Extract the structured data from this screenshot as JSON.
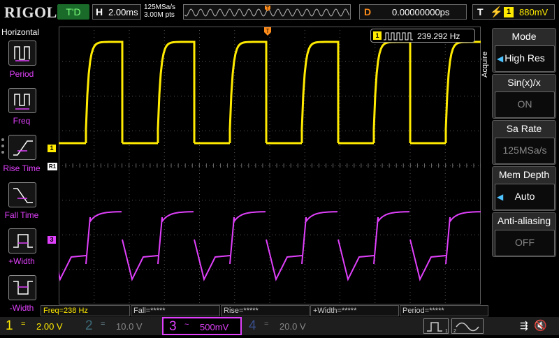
{
  "brand": "RIGOL",
  "trigger_status": "T'D",
  "horizontal": {
    "key": "H",
    "timebase": "2.00ms",
    "sample_rate": "125MSa/s",
    "points": "3.00M pts"
  },
  "delay": {
    "key": "D",
    "value": "0.00000000ps"
  },
  "trigger": {
    "key": "T",
    "edge_icon": "rising-edge-icon",
    "source": "1",
    "level": "880mV",
    "marker": "T"
  },
  "left_menu": {
    "title": "Horizontal",
    "items": [
      {
        "name": "period",
        "label": "Period"
      },
      {
        "name": "freq",
        "label": "Freq"
      },
      {
        "name": "rise-time",
        "label": "Rise Time"
      },
      {
        "name": "fall-time",
        "label": "Fall Time"
      },
      {
        "name": "pos-width",
        "label": "+Width"
      },
      {
        "name": "neg-width",
        "label": "-Width"
      }
    ]
  },
  "readout": {
    "channel": "1",
    "frequency": "239.292 Hz"
  },
  "markers": {
    "ch1": "1",
    "ref": "R1",
    "ch3": "3"
  },
  "right_menu": {
    "tab": "Acquire",
    "items": [
      {
        "title": "Mode",
        "value": "High Res",
        "enabled": true,
        "has_arrow": true
      },
      {
        "title": "Sin(x)/x",
        "value": "ON",
        "enabled": false,
        "has_arrow": false
      },
      {
        "title": "Sa Rate",
        "value": "125MSa/s",
        "enabled": false,
        "has_arrow": false
      },
      {
        "title": "Mem Depth",
        "value": "Auto",
        "enabled": true,
        "has_arrow": true
      },
      {
        "title": "Anti-aliasing",
        "value": "OFF",
        "enabled": false,
        "has_arrow": false
      }
    ]
  },
  "measurements": {
    "freq": "Freq=238 Hz",
    "fall": "Fall=*****",
    "rise": "Rise=*****",
    "pos_width": "+Width=*****",
    "period": "Period=*****"
  },
  "channels": [
    {
      "num": "1",
      "coupling": "=",
      "scale": "2.00 V",
      "color": "#ffea00",
      "active": true
    },
    {
      "num": "2",
      "coupling": "=",
      "scale": "10.0 V",
      "color": "#00c0ff",
      "active": false
    },
    {
      "num": "3",
      "coupling": "~",
      "scale": "500mV",
      "color": "#e040fb",
      "active": true
    },
    {
      "num": "4",
      "coupling": "=",
      "scale": "20.0 V",
      "color": "#2f6bff",
      "active": false
    }
  ],
  "colors": {
    "ch1": "#ffea00",
    "ch3": "#e040fb",
    "accent": "#ff8c1a",
    "grid": "#5a5a5a"
  }
}
